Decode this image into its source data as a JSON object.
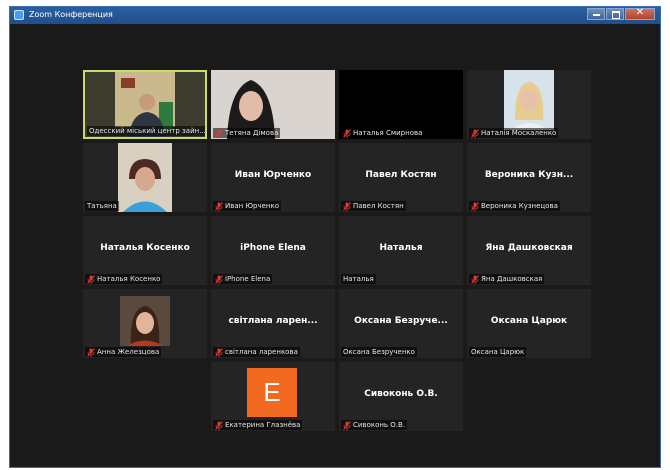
{
  "window": {
    "title": "Zoom Конференция",
    "controls": [
      "minimize",
      "maximize",
      "close"
    ],
    "close_glyph": "✕"
  },
  "participants": [
    {
      "name": "Одесский міський центр зайн...",
      "big": "",
      "muted": false,
      "video": true
    },
    {
      "name": "Тетяна Дімова",
      "big": "",
      "muted": true,
      "video": true
    },
    {
      "name": "Наталья Смирнова",
      "big": "",
      "muted": true,
      "video": false
    },
    {
      "name": "Наталія Москаленко",
      "big": "",
      "muted": true,
      "video": true
    },
    {
      "name": "Татьяна",
      "big": "",
      "muted": false,
      "video": true
    },
    {
      "name": "Иван Юрченко",
      "big": "Иван Юрченко",
      "muted": true,
      "video": false
    },
    {
      "name": "Павел Костян",
      "big": "Павел Костян",
      "muted": true,
      "video": false
    },
    {
      "name": "Вероника Кузнецова",
      "big": "Вероника  Кузн...",
      "muted": true,
      "video": false
    },
    {
      "name": "Наталья Косенко",
      "big": "Наталья Косенко",
      "muted": true,
      "video": false
    },
    {
      "name": "iPhone Elena",
      "big": "iPhone Elena",
      "muted": true,
      "video": false
    },
    {
      "name": "Наталья",
      "big": "Наталья",
      "muted": false,
      "video": false
    },
    {
      "name": "Яна Дашковская",
      "big": "Яна Дашковская",
      "muted": true,
      "video": false
    },
    {
      "name": "Анна Железцова",
      "big": "",
      "muted": true,
      "video": true
    },
    {
      "name": "світлана ларенкова",
      "big": "світлана ларен...",
      "muted": true,
      "video": false
    },
    {
      "name": "Оксана Безрученко",
      "big": "Оксана  Безруче...",
      "muted": false,
      "video": false
    },
    {
      "name": "Оксана Царюк",
      "big": "Оксана Царюк",
      "muted": false,
      "video": false
    },
    {
      "name": "Екатерина Глазнёва",
      "big": "",
      "muted": true,
      "video": false,
      "avatar_letter": "E"
    },
    {
      "name": "Сивоконь О.В.",
      "big": "Сивоконь О.В.",
      "muted": true,
      "video": false
    }
  ],
  "colors": {
    "background": "#1a1a1a",
    "tile": "#242424",
    "active_speaker_border": "#c7dc6a",
    "muted_icon": "#e0392f",
    "avatar_bg": "#f26a21"
  }
}
